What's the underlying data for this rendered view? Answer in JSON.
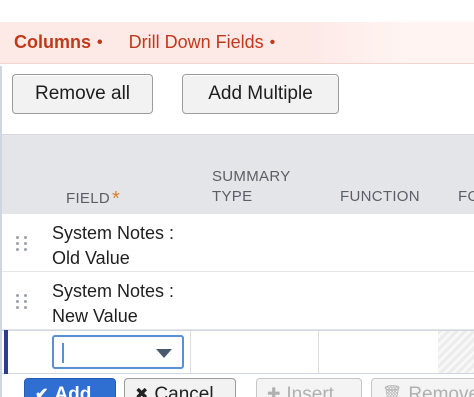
{
  "tabs": [
    {
      "label": "Columns",
      "marker": "•"
    },
    {
      "label": "Drill Down Fields",
      "marker": "•"
    }
  ],
  "toolbar": {
    "remove_all_label": "Remove all",
    "add_multiple_label": "Add Multiple"
  },
  "table": {
    "headers": {
      "field": "FIELD",
      "required_marker": "*",
      "summary_type": "SUMMARY TYPE",
      "function": "FUNCTION",
      "cut": "FO"
    },
    "rows": [
      {
        "field_line1": "System Notes :",
        "field_line2": "Old Value"
      },
      {
        "field_line1": "System Notes :",
        "field_line2": "New Value"
      }
    ],
    "edit_row": {
      "field_value": ""
    }
  },
  "actions": {
    "add_label": "Add",
    "add_icon": "check-icon",
    "cancel_label": "Cancel",
    "cancel_icon": "x-icon",
    "insert_label": "Insert",
    "insert_icon": "plus-icon",
    "remove_label": "Remove",
    "remove_icon": "trash-icon"
  },
  "colors": {
    "tab_text": "#c0391b",
    "tab_bg": "#fde9e6",
    "primary": "#2f6fd1",
    "required": "#d9822b"
  }
}
